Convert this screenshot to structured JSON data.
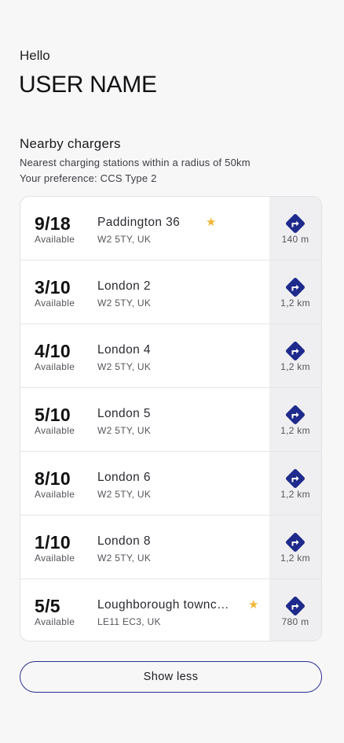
{
  "greeting": "Hello",
  "username": "USER NAME",
  "section": {
    "title": "Nearby chargers",
    "subtitle": "Nearest charging stations within a radius of 50km",
    "preference": "Your preference: CCS Type 2"
  },
  "chargers": [
    {
      "count": "9/18",
      "available": "Available",
      "name": "Paddington 36",
      "address": "W2 5TY, UK",
      "distance": "140 m",
      "favorite": true
    },
    {
      "count": "3/10",
      "available": "Available",
      "name": "London 2",
      "address": "W2 5TY, UK",
      "distance": "1,2 km",
      "favorite": false
    },
    {
      "count": "4/10",
      "available": "Available",
      "name": "London 4",
      "address": "W2 5TY, UK",
      "distance": "1,2 km",
      "favorite": false
    },
    {
      "count": "5/10",
      "available": "Available",
      "name": "London 5",
      "address": "W2 5TY, UK",
      "distance": "1,2 km",
      "favorite": false
    },
    {
      "count": "8/10",
      "available": "Available",
      "name": "London 6",
      "address": "W2 5TY, UK",
      "distance": "1,2 km",
      "favorite": false
    },
    {
      "count": "1/10",
      "available": "Available",
      "name": "London 8",
      "address": "W2 5TY, UK",
      "distance": "1,2 km",
      "favorite": false
    },
    {
      "count": "5/5",
      "available": "Available",
      "name": "Loughborough townc…",
      "address": "LE11 EC3, UK",
      "distance": "780 m",
      "favorite": true
    }
  ],
  "show_less_label": "Show less",
  "icons": {
    "favorite": "star-icon",
    "navigate": "directions-icon"
  },
  "colors": {
    "accent": "#1e2a8c",
    "star": "#f2b534",
    "nav_bg": "#efeff1"
  }
}
